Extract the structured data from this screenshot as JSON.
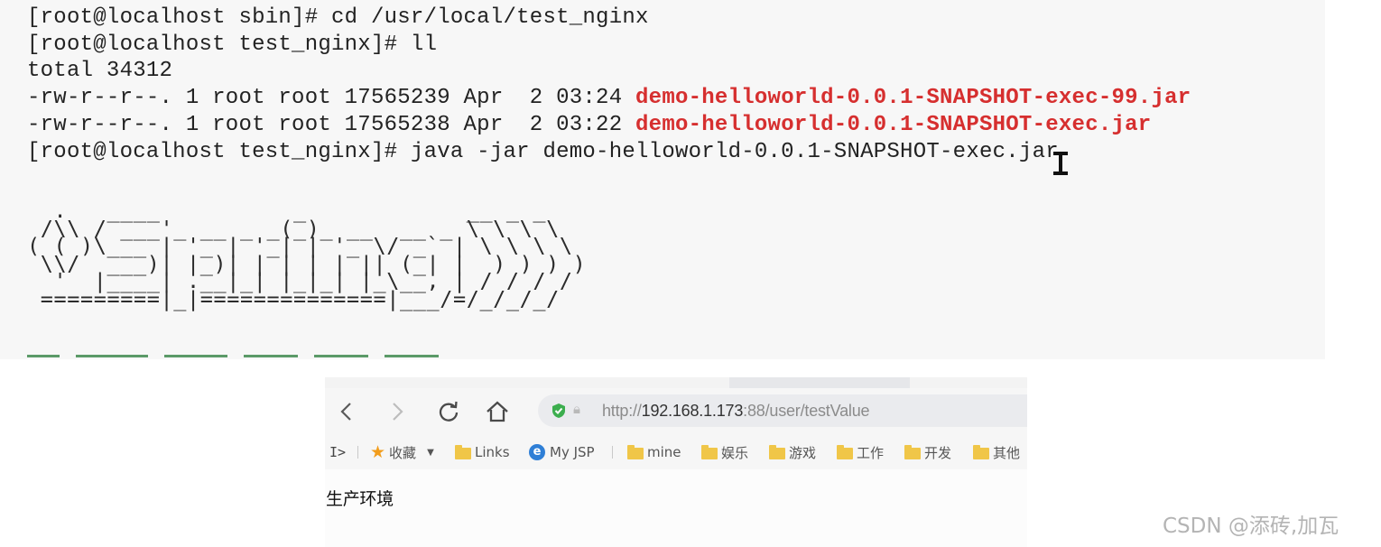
{
  "terminal": {
    "lines": [
      "[root@localhost sbin]# cd /usr/local/test_nginx",
      "[root@localhost test_nginx]# ll",
      "total 34312"
    ],
    "files": [
      {
        "meta": "-rw-r--r--. 1 root root 17565239 Apr  2 03:24 ",
        "name": "demo-helloworld-0.0.1-SNAPSHOT-exec-99.jar"
      },
      {
        "meta": "-rw-r--r--. 1 root root 17565238 Apr  2 03:22 ",
        "name": "demo-helloworld-0.0.1-SNAPSHOT-exec.jar"
      }
    ],
    "command": "[root@localhost test_nginx]# java -jar demo-helloworld-0.0.1-SNAPSHOT-exec.jar",
    "banner": "  .   ____          _            __ _ _\n /\\\\ / ___'_ __ _ _(_)_ __  __ _ \\ \\ \\ \\\n( ( )\\___ | '_ | '_| | '_ \\/ _` | \\ \\ \\ \\\n \\\\/  ___)| |_)| | | | | || (_| |  ) ) ) )\n  '  |____| .__|_| |_|_| |_\\__, | / / / /\n =========|_|==============|___/=/_/_/_/",
    "file_name_color": "#d62f2f"
  },
  "browser": {
    "nav": {
      "back_icon": "back-arrow-icon",
      "forward_icon": "forward-arrow-icon",
      "reload_icon": "reload-icon",
      "home_icon": "home-icon"
    },
    "address": {
      "scheme": "http://",
      "host": "192.168.1.173",
      "path": ":88/user/testValue"
    },
    "bookmarks": {
      "toggle": "I>",
      "favorites": "收藏",
      "items": [
        "Links",
        "My JSP",
        "mine",
        "娱乐",
        "游戏",
        "工作",
        "开发",
        "其他"
      ]
    },
    "page_text": "生产环境"
  },
  "watermark": "CSDN @添砖,加瓦",
  "colors": {
    "shield_green": "#3cae4e",
    "star_orange": "#f29d1c",
    "folder_yellow": "#f0c648"
  }
}
